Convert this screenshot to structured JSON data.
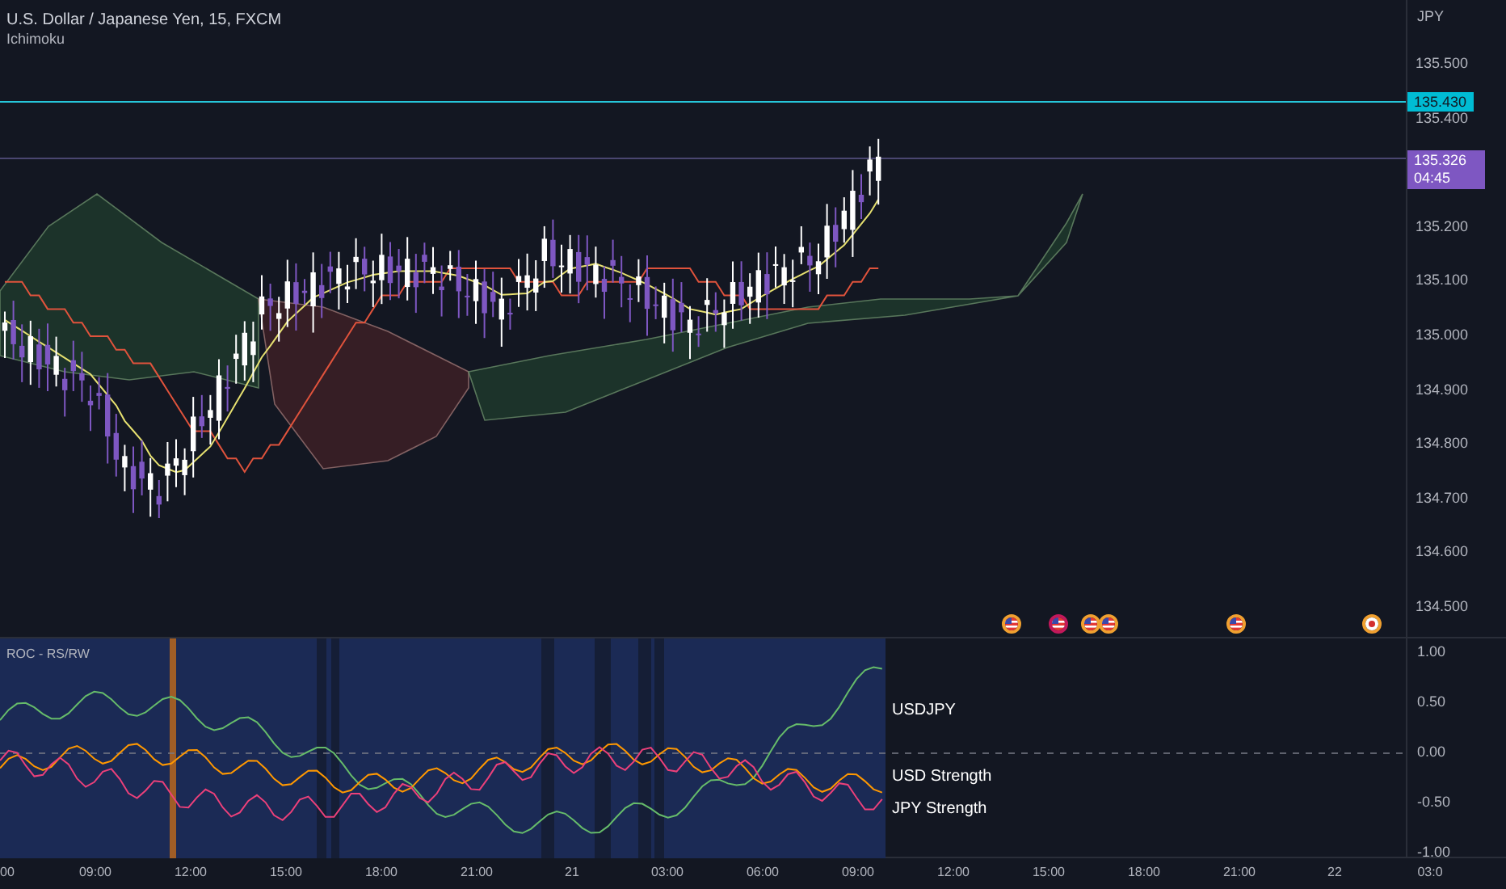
{
  "legend": {
    "symbol": "U.S. Dollar / Japanese Yen, 15, FXCM",
    "indicator": "Ichimoku"
  },
  "price_axis": {
    "currency": "JPY",
    "ticks": [
      "135.500",
      "135.400",
      "135.200",
      "135.100",
      "135.000",
      "134.900",
      "134.800",
      "134.700",
      "134.600",
      "134.500"
    ],
    "alert_label": "135.430",
    "last_price": "135.326",
    "countdown": "04:45"
  },
  "events": [
    {
      "kind": "us",
      "color": "#f0a030"
    },
    {
      "kind": "us",
      "color": "#c2185b"
    },
    {
      "kind": "us",
      "color": "#f0a030"
    },
    {
      "kind": "us",
      "color": "#f0a030"
    },
    {
      "kind": "us",
      "color": "#f0a030"
    },
    {
      "kind": "jp",
      "color": "#f0a030"
    }
  ],
  "indicator_pane": {
    "title": "ROC - RS/RW",
    "labels": [
      "USDJPY",
      "USD Strength",
      "JPY Strength"
    ],
    "ticks": [
      "1.00",
      "0.50",
      "0.00",
      "-0.50",
      "-1.00"
    ]
  },
  "time_axis": [
    "00",
    "09:00",
    "12:00",
    "15:00",
    "18:00",
    "21:00",
    "21",
    "03:00",
    "06:00",
    "09:00",
    "12:00",
    "15:00",
    "18:00",
    "21:00",
    "22",
    "03:0"
  ]
}
